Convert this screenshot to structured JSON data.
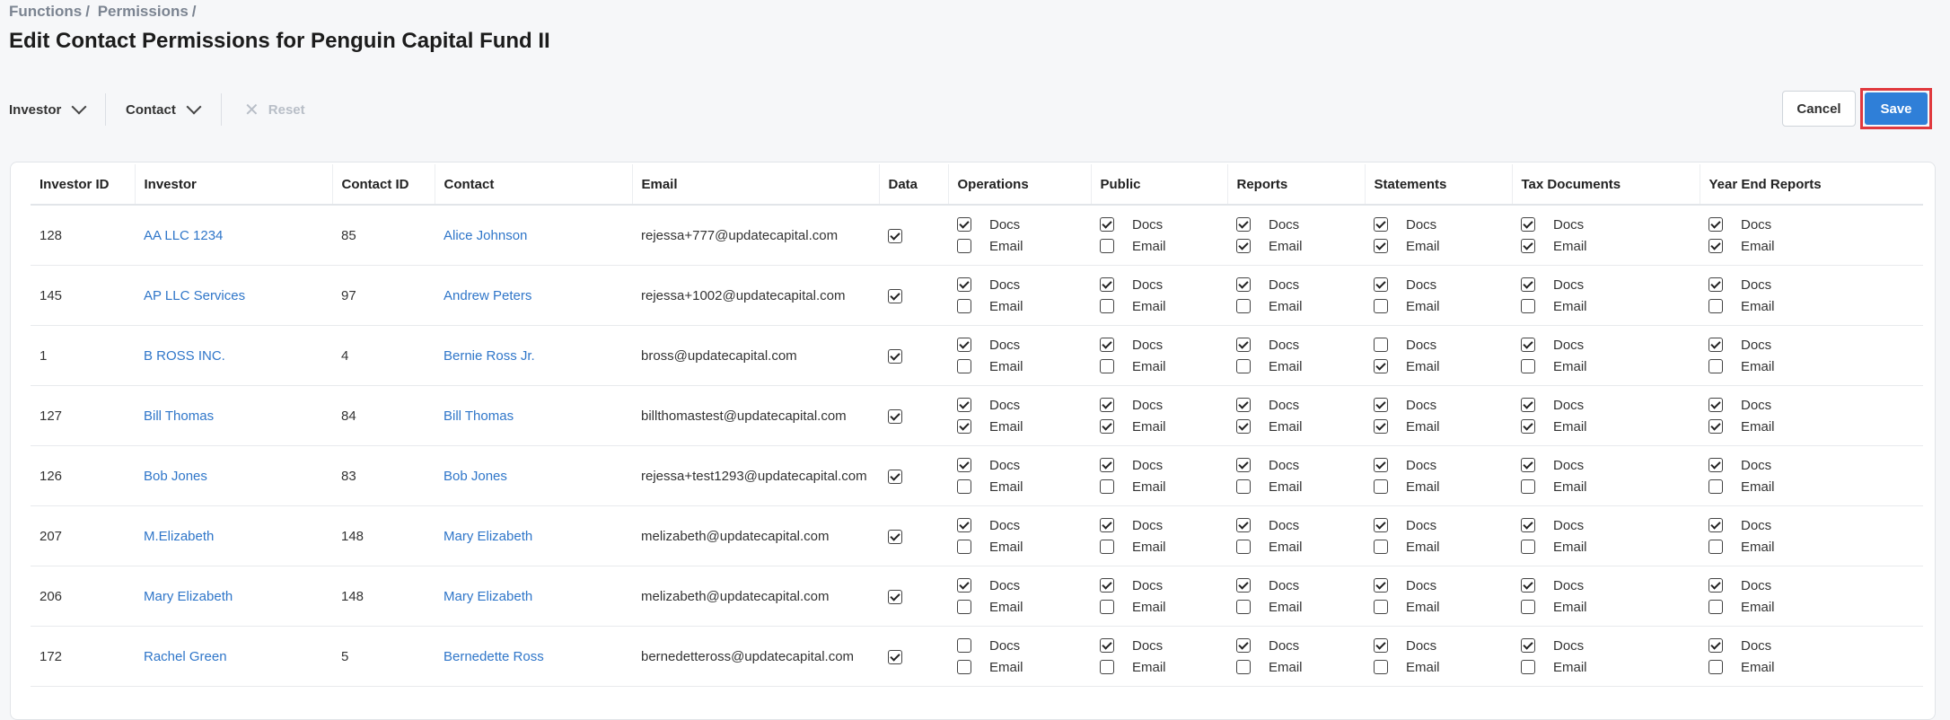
{
  "breadcrumb": [
    "Functions",
    "/",
    "Permissions",
    "/"
  ],
  "page_title": "Edit Contact Permissions for Penguin Capital Fund II",
  "toolbar": {
    "investor_filter": "Investor",
    "contact_filter": "Contact",
    "reset_label": "Reset",
    "cancel_label": "Cancel",
    "save_label": "Save"
  },
  "table": {
    "columns": [
      "Investor ID",
      "Investor",
      "Contact ID",
      "Contact",
      "Email",
      "Data",
      "Operations",
      "Public",
      "Reports",
      "Statements",
      "Tax Documents",
      "Year End Reports"
    ],
    "perm_labels": {
      "docs": "Docs",
      "email": "Email"
    },
    "rows": [
      {
        "investor_id": "128",
        "investor": "AA LLC 1234",
        "contact_id": "85",
        "contact": "Alice Johnson",
        "email": "rejessa+777@updatecapital.com",
        "data": true,
        "perms": [
          [
            true,
            false
          ],
          [
            true,
            false
          ],
          [
            true,
            true
          ],
          [
            true,
            true
          ],
          [
            true,
            true
          ],
          [
            true,
            true
          ]
        ]
      },
      {
        "investor_id": "145",
        "investor": "AP LLC Services",
        "contact_id": "97",
        "contact": "Andrew Peters",
        "email": "rejessa+1002@updatecapital.com",
        "data": true,
        "perms": [
          [
            true,
            false
          ],
          [
            true,
            false
          ],
          [
            true,
            false
          ],
          [
            true,
            false
          ],
          [
            true,
            false
          ],
          [
            true,
            false
          ]
        ]
      },
      {
        "investor_id": "1",
        "investor": "B ROSS INC.",
        "contact_id": "4",
        "contact": "Bernie Ross Jr.",
        "email": "bross@updatecapital.com",
        "data": true,
        "perms": [
          [
            true,
            false
          ],
          [
            true,
            false
          ],
          [
            true,
            false
          ],
          [
            false,
            true
          ],
          [
            true,
            false
          ],
          [
            true,
            false
          ]
        ]
      },
      {
        "investor_id": "127",
        "investor": "Bill Thomas",
        "contact_id": "84",
        "contact": "Bill Thomas",
        "email": "billthomastest@updatecapital.com",
        "data": true,
        "perms": [
          [
            true,
            true
          ],
          [
            true,
            true
          ],
          [
            true,
            true
          ],
          [
            true,
            true
          ],
          [
            true,
            true
          ],
          [
            true,
            true
          ]
        ]
      },
      {
        "investor_id": "126",
        "investor": "Bob Jones",
        "contact_id": "83",
        "contact": "Bob Jones",
        "email": "rejessa+test1293@updatecapital.com",
        "data": true,
        "perms": [
          [
            true,
            false
          ],
          [
            true,
            false
          ],
          [
            true,
            false
          ],
          [
            true,
            false
          ],
          [
            true,
            false
          ],
          [
            true,
            false
          ]
        ]
      },
      {
        "investor_id": "207",
        "investor": "M.Elizabeth",
        "contact_id": "148",
        "contact": "Mary Elizabeth",
        "email": "melizabeth@updatecapital.com",
        "data": true,
        "perms": [
          [
            true,
            false
          ],
          [
            true,
            false
          ],
          [
            true,
            false
          ],
          [
            true,
            false
          ],
          [
            true,
            false
          ],
          [
            true,
            false
          ]
        ]
      },
      {
        "investor_id": "206",
        "investor": "Mary Elizabeth",
        "contact_id": "148",
        "contact": "Mary Elizabeth",
        "email": "melizabeth@updatecapital.com",
        "data": true,
        "perms": [
          [
            true,
            false
          ],
          [
            true,
            false
          ],
          [
            true,
            false
          ],
          [
            true,
            false
          ],
          [
            true,
            false
          ],
          [
            true,
            false
          ]
        ]
      },
      {
        "investor_id": "172",
        "investor": "Rachel Green",
        "contact_id": "5",
        "contact": "Bernedette Ross",
        "email": "bernedetteross@updatecapital.com",
        "data": true,
        "perms": [
          [
            false,
            false
          ],
          [
            true,
            false
          ],
          [
            true,
            false
          ],
          [
            true,
            false
          ],
          [
            true,
            false
          ],
          [
            true,
            false
          ]
        ]
      }
    ]
  }
}
